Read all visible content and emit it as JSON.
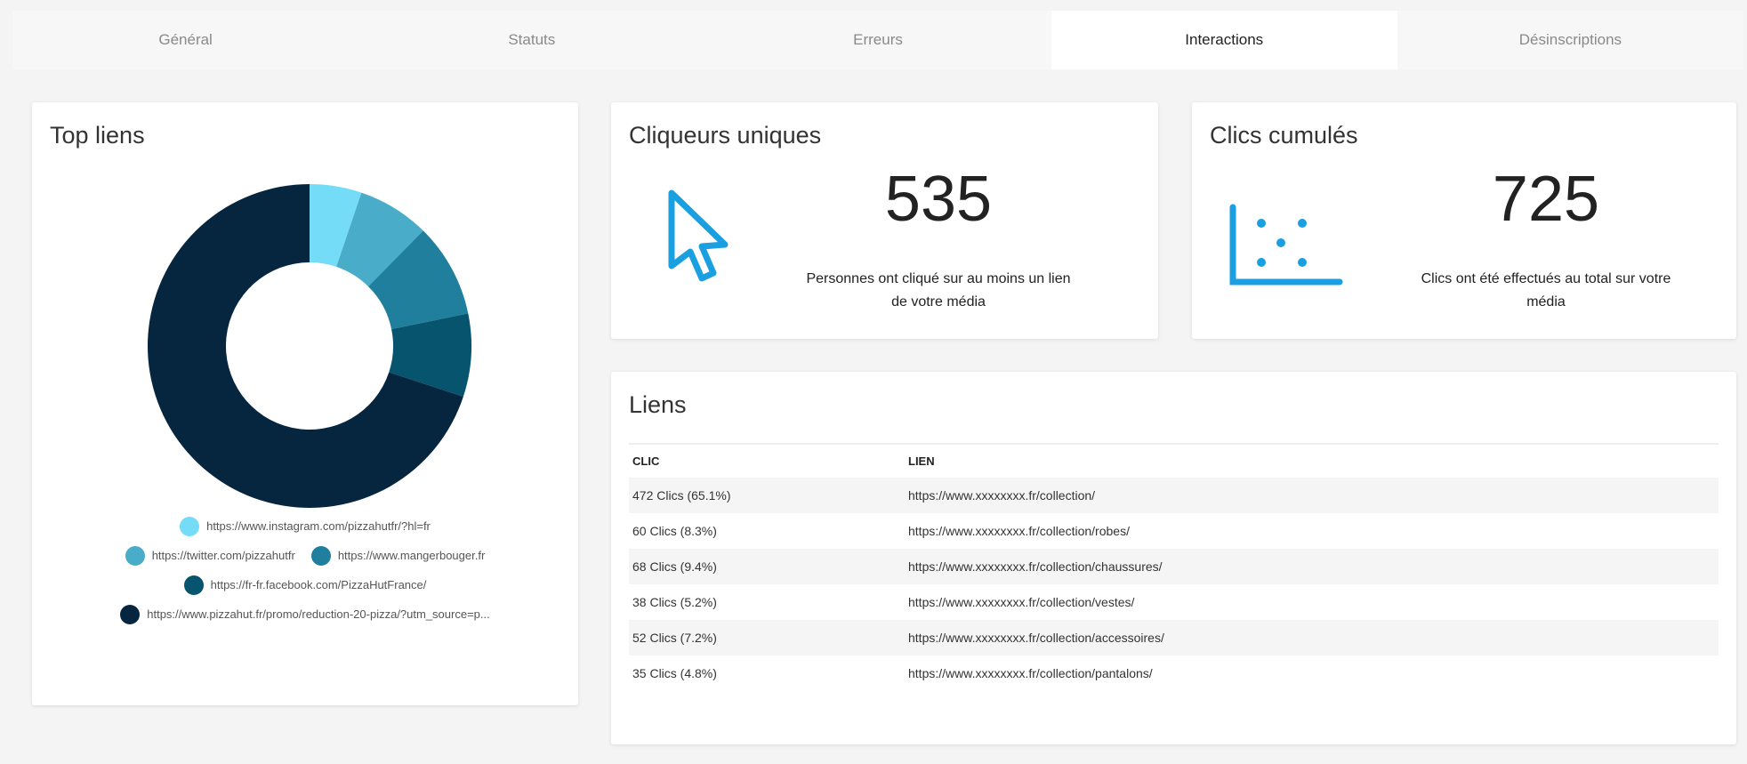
{
  "tabs": [
    {
      "label": "Général"
    },
    {
      "label": "Statuts"
    },
    {
      "label": "Erreurs"
    },
    {
      "label": "Interactions",
      "active": true
    },
    {
      "label": "Désinscriptions"
    }
  ],
  "top_liens": {
    "title": "Top liens",
    "chart_data": {
      "type": "pie",
      "variant": "donut",
      "categories": [
        "https://www.instagram.com/pizzahutfr/?hl=fr",
        "https://twitter.com/pizzahutfr",
        "https://www.mangerbouger.fr",
        "https://fr-fr.facebook.com/PizzaHutFrance/",
        "https://www.pizzahut.fr/promo/reduction-20-pizza/?utm_source=p..."
      ],
      "values": [
        5.2,
        7.2,
        9.4,
        8.3,
        70
      ],
      "colors": [
        "#74dcf7",
        "#49adc9",
        "#1f7f9d",
        "#06546e",
        "#06263f"
      ]
    }
  },
  "cliqueurs": {
    "title": "Cliqueurs uniques",
    "value": "535",
    "desc_line1": "Personnes ont cliqué sur au moins un lien",
    "desc_line2": "de votre média",
    "icon": "cursor-icon"
  },
  "clics": {
    "title": "Clics cumulés",
    "value": "725",
    "desc_line1": "Clics ont été effectués au total sur votre",
    "desc_line2": "média",
    "icon": "scatter-chart-icon"
  },
  "liens": {
    "title": "Liens",
    "headers": [
      "CLIC",
      "LIEN"
    ],
    "rows": [
      [
        "472 Clics (65.1%)",
        "https://www.xxxxxxxx.fr/collection/"
      ],
      [
        "60 Clics (8.3%)",
        "https://www.xxxxxxxx.fr/collection/robes/"
      ],
      [
        "68 Clics (9.4%)",
        "https://www.xxxxxxxx.fr/collection/chaussures/"
      ],
      [
        "38 Clics (5.2%)",
        "https://www.xxxxxxxx.fr/collection/vestes/"
      ],
      [
        "52 Clics (7.2%)",
        "https://www.xxxxxxxx.fr/collection/accessoires/"
      ],
      [
        "35 Clics (4.8%)",
        "https://www.xxxxxxxx.fr/collection/pantalons/"
      ]
    ]
  },
  "accent_color": "#1a9fe0"
}
